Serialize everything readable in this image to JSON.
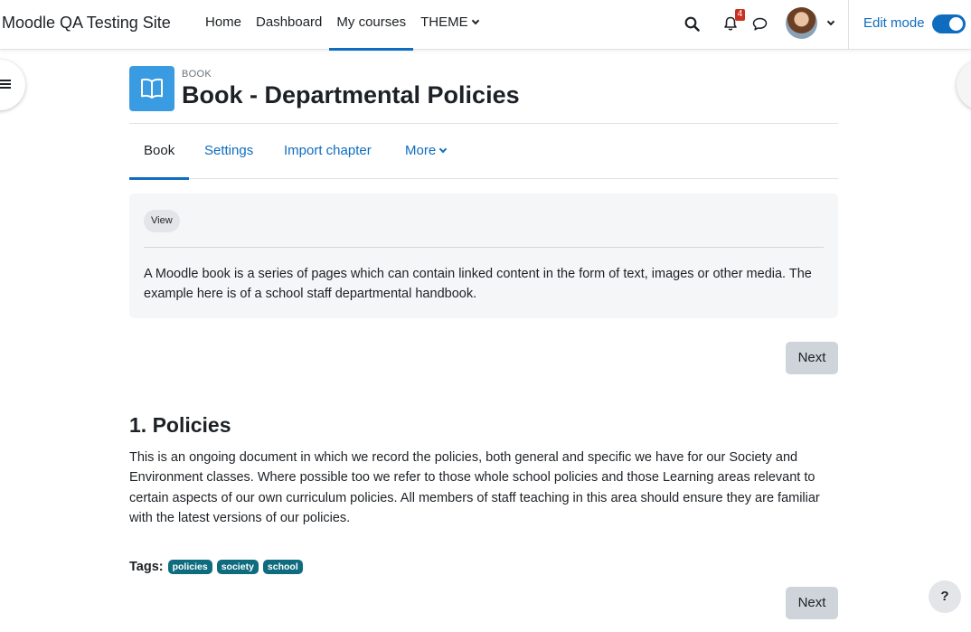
{
  "navbar": {
    "brand": "Moodle QA Testing Site",
    "links": [
      "Home",
      "Dashboard",
      "My courses",
      "THEME"
    ],
    "notification_count": "4",
    "edit_mode_label": "Edit mode",
    "edit_mode_on": true,
    "accent_color": "#0f6cbf"
  },
  "header": {
    "module_type": "BOOK",
    "title": "Book - Departmental Policies",
    "module_icon": "book-icon",
    "module_icon_color": "#399be2"
  },
  "secondary_nav": {
    "items": [
      "Book",
      "Settings",
      "Import chapter",
      "More"
    ]
  },
  "activity_info": {
    "view_label": "View",
    "description": "A  Moodle book is a series of pages which can contain linked content  in the form of text, images or other media. The example here is of a school staff departmental handbook."
  },
  "buttons": {
    "next_label": "Next"
  },
  "chapter": {
    "title": "1. Policies",
    "body": "This is an ongoing document in which we record the policies, both general and specific we have for our Society and Environment classes. Where possible too we refer to those whole school policies and those Learning areas relevant to certain aspects of our own curriculum policies. All members of staff teaching in this area should ensure they are familiar with the latest versions of our policies."
  },
  "tags": {
    "label": "Tags:",
    "items": [
      "policies",
      "society",
      "school"
    ],
    "color": "#0f6c7e"
  },
  "help": {
    "label": "?"
  }
}
